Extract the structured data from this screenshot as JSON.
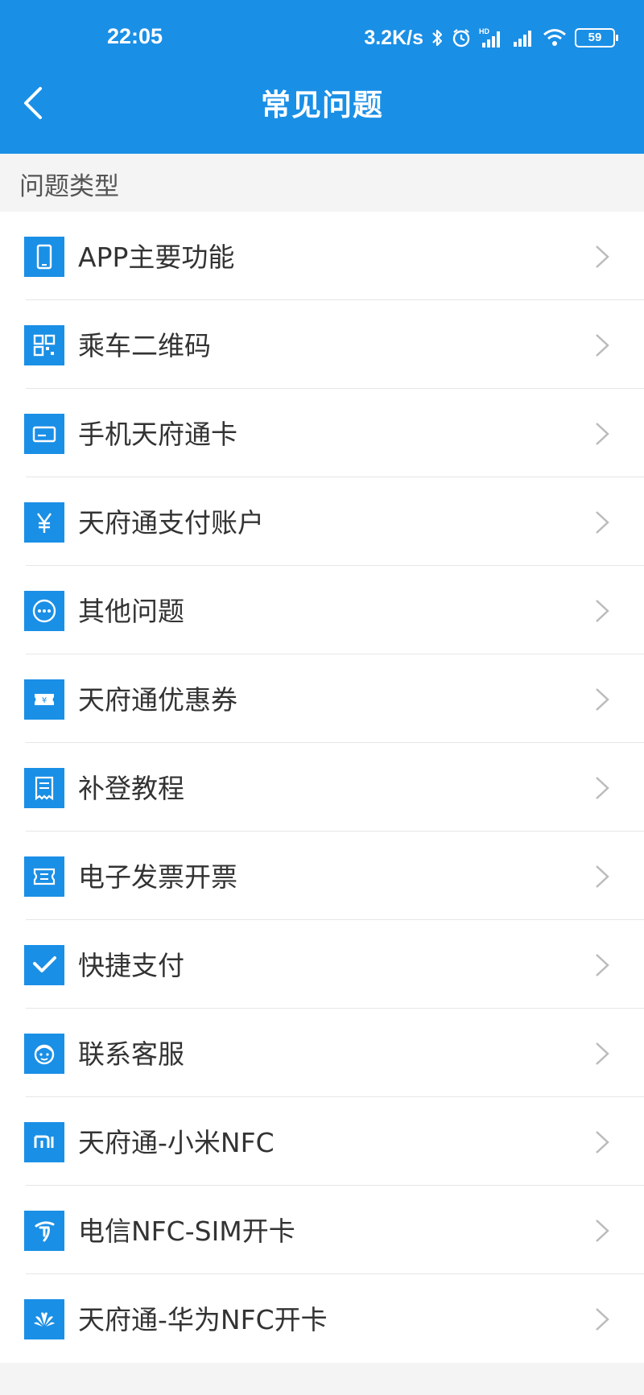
{
  "status_bar": {
    "time": "22:05",
    "network_speed": "3.2K/s",
    "battery_level": "59"
  },
  "header": {
    "title": "常见问题"
  },
  "section": {
    "label": "问题类型"
  },
  "menu_items": [
    {
      "label": "APP主要功能",
      "icon": "phone-icon"
    },
    {
      "label": "乘车二维码",
      "icon": "qr-code-icon"
    },
    {
      "label": "手机天府通卡",
      "icon": "card-icon"
    },
    {
      "label": "天府通支付账户",
      "icon": "yuan-icon"
    },
    {
      "label": "其他问题",
      "icon": "more-dots-icon"
    },
    {
      "label": "天府通优惠券",
      "icon": "coupon-icon"
    },
    {
      "label": "补登教程",
      "icon": "receipt-icon"
    },
    {
      "label": "电子发票开票",
      "icon": "invoice-icon"
    },
    {
      "label": "快捷支付",
      "icon": "check-icon"
    },
    {
      "label": "联系客服",
      "icon": "customer-service-icon"
    },
    {
      "label": "天府通-小米NFC",
      "icon": "xiaomi-logo-icon"
    },
    {
      "label": "电信NFC-SIM开卡",
      "icon": "china-telecom-logo-icon"
    },
    {
      "label": "天府通-华为NFC开卡",
      "icon": "huawei-logo-icon"
    }
  ],
  "colors": {
    "brand_blue": "#1a8fe6",
    "background": "#f4f4f4"
  }
}
